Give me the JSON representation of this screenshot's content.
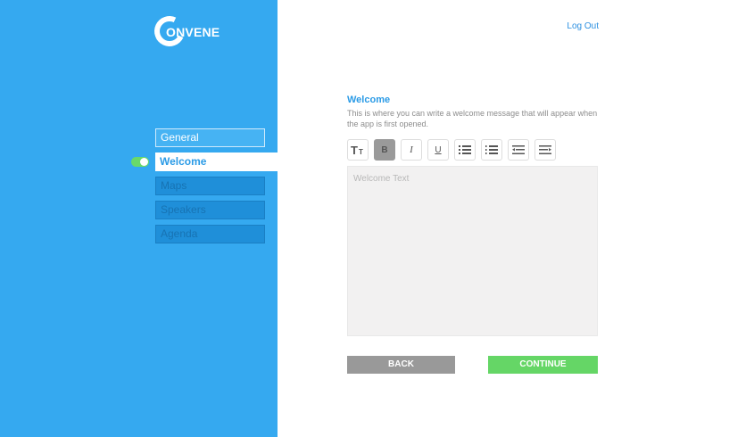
{
  "brand": {
    "logo_text": "ONVENE"
  },
  "header": {
    "logout_label": "Log Out"
  },
  "sidebar": {
    "items": [
      {
        "label": "General",
        "state": "enabled"
      },
      {
        "label": "Welcome",
        "state": "active"
      },
      {
        "label": "Maps",
        "state": "locked"
      },
      {
        "label": "Speakers",
        "state": "locked"
      },
      {
        "label": "Agenda",
        "state": "locked"
      }
    ],
    "toggle_on": true
  },
  "section": {
    "title": "Welcome",
    "description": "This is where you can write a welcome message that will appear when the app is first opened."
  },
  "toolbar": {
    "buttons": [
      {
        "icon": "text-size-icon"
      },
      {
        "icon": "bold-icon",
        "label": "B",
        "active": true
      },
      {
        "icon": "italic-icon",
        "label": "I"
      },
      {
        "icon": "underline-icon",
        "label": "U"
      },
      {
        "icon": "bullet-list-icon"
      },
      {
        "icon": "numbered-list-icon"
      },
      {
        "icon": "outdent-icon"
      },
      {
        "icon": "indent-icon"
      }
    ]
  },
  "editor": {
    "placeholder": "Welcome Text"
  },
  "actions": {
    "back_label": "BACK",
    "continue_label": "CONTINUE"
  },
  "colors": {
    "sidebar": "#35a9f0",
    "accent": "#2b9be6",
    "continue": "#65d666",
    "back": "#999999",
    "editor_bg": "#f2f1f1"
  }
}
